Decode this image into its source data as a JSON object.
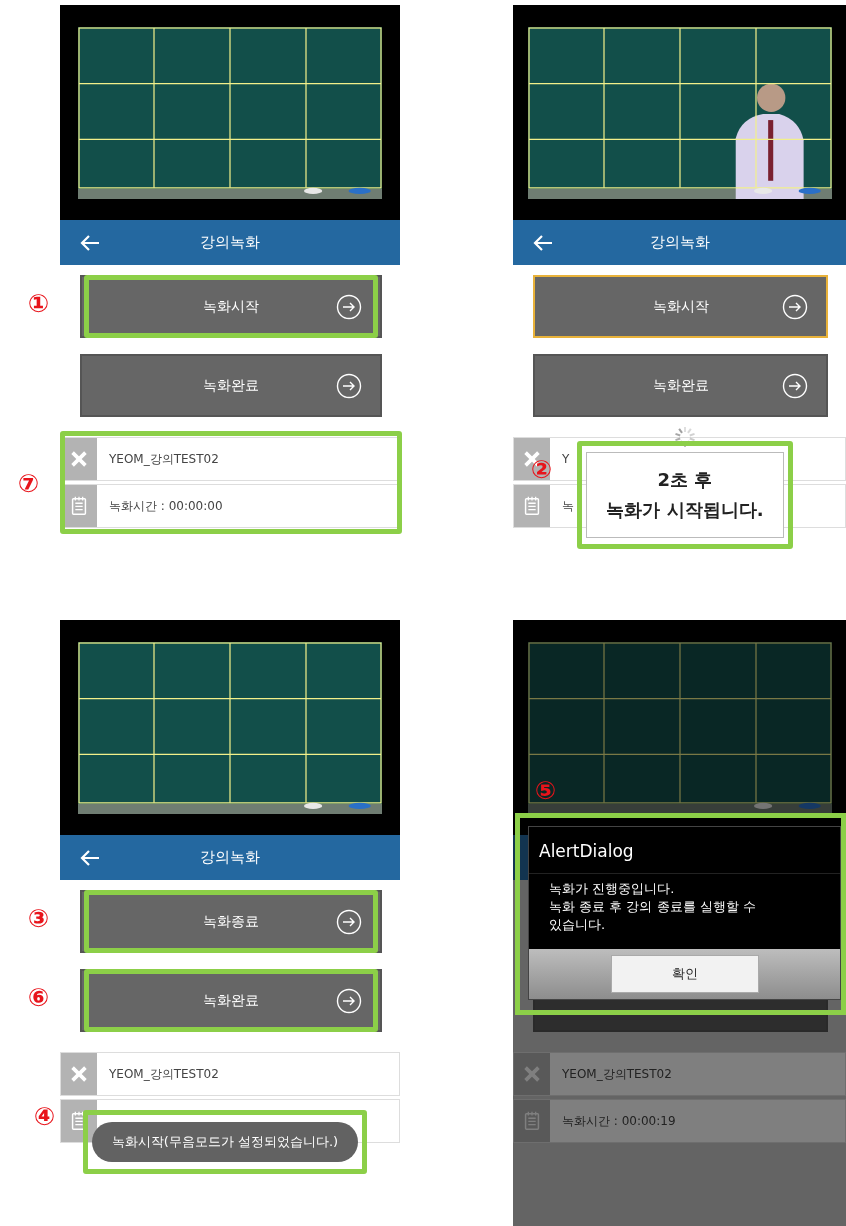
{
  "panels": [
    {
      "video": {
        "kind": "board"
      },
      "header": {
        "title": "강의녹화"
      },
      "buttons": [
        {
          "label": "녹화시작",
          "focused": false,
          "marker": "①"
        },
        {
          "label": "녹화완료",
          "focused": false
        }
      ],
      "info": {
        "marker": "⑦",
        "rows": [
          {
            "kind": "name",
            "text": "YEOM_강의TEST02"
          },
          {
            "kind": "time",
            "text": "녹화시간 : 00:00:00"
          }
        ]
      }
    },
    {
      "video": {
        "kind": "lecturer"
      },
      "header": {
        "title": "강의녹화"
      },
      "buttons": [
        {
          "label": "녹화시작",
          "focused": true
        },
        {
          "label": "녹화완료",
          "focused": false
        }
      ],
      "loading": true,
      "info": {
        "rows": [
          {
            "kind": "name",
            "text": "Y"
          },
          {
            "kind": "time",
            "text": "녹"
          }
        ]
      },
      "toast": {
        "kind": "box",
        "marker": "②",
        "lines": [
          "2초 후",
          "녹화가 시작됩니다."
        ]
      }
    },
    {
      "video": {
        "kind": "board"
      },
      "header": {
        "title": "강의녹화"
      },
      "buttons": [
        {
          "label": "녹화종료",
          "focused": false,
          "marker": "③"
        },
        {
          "label": "녹화완료",
          "focused": false,
          "marker": "⑥"
        }
      ],
      "info": {
        "rows": [
          {
            "kind": "name",
            "text": "YEOM_강의TEST02"
          },
          {
            "kind": "time"
          }
        ]
      },
      "toast": {
        "kind": "pill",
        "marker": "④",
        "lines": [
          "녹화시작(무음모드가 설정되었습니다.)"
        ]
      }
    },
    {
      "video": {
        "kind": "board"
      },
      "buttons": [
        {
          "kind": "blank"
        },
        {
          "kind": "blank"
        }
      ],
      "info": {
        "rows": [
          {
            "kind": "name",
            "text": "YEOM_강의TEST02"
          },
          {
            "kind": "time",
            "text": "녹화시간 : 00:00:19"
          }
        ]
      },
      "dialog": {
        "marker": "⑤",
        "title": "AlertDialog",
        "message_lines": [
          "녹화가 진행중입니다.",
          "녹화 종료 후 강의 종료를 실행할 수",
          "있습니다."
        ],
        "button": "확인"
      }
    }
  ]
}
